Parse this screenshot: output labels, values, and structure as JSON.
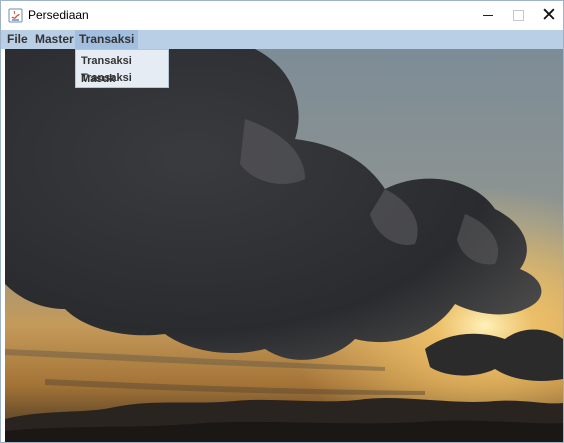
{
  "window": {
    "title": "Persediaan",
    "icon": "java-app-icon",
    "controls": {
      "minimize": "minimize-icon",
      "maximize": "maximize-icon",
      "close": "close-icon"
    }
  },
  "menubar": {
    "items": [
      {
        "label": "File"
      },
      {
        "label": "Master"
      },
      {
        "label": "Transaksi"
      }
    ]
  },
  "dropdown": {
    "items": [
      {
        "label": "Transaksi Masuk"
      },
      {
        "label": "Transaksi Keluar"
      }
    ]
  },
  "colors": {
    "menubar": "#b8cfe5",
    "menu_selected": "#a3bfe0",
    "dropdown_bg": "#e6ecf4",
    "sky_top": "#8a9aa5",
    "sky_glow": "#f5c86a",
    "cloud_dark": "#2f3034"
  }
}
